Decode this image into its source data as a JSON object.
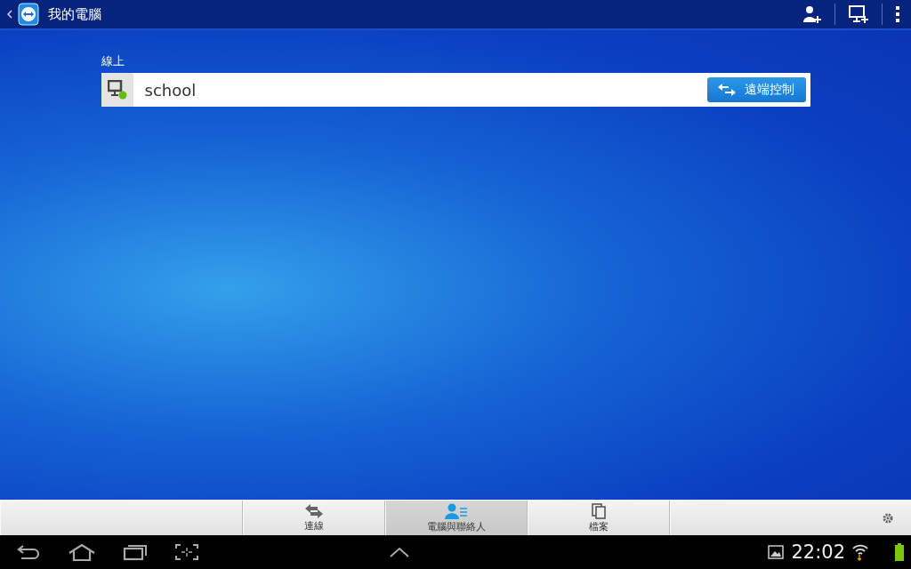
{
  "action_bar": {
    "title": "我的電腦"
  },
  "section": {
    "label": "線上"
  },
  "computers": [
    {
      "name": "school",
      "online": true,
      "action": "遠端控制"
    }
  ],
  "tabs": [
    {
      "kind": "connect",
      "label": "連線",
      "selected": false
    },
    {
      "kind": "contacts",
      "label": "電腦與聯絡人",
      "selected": true
    },
    {
      "kind": "files",
      "label": "檔案",
      "selected": false
    }
  ],
  "status_bar": {
    "time": "22:02"
  }
}
